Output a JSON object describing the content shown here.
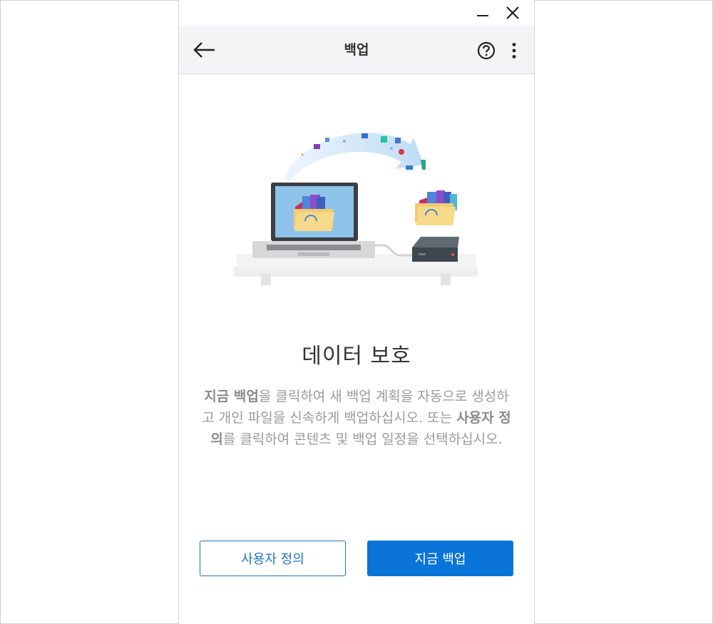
{
  "window": {
    "minimize_icon": "minimize-icon",
    "close_icon": "close-icon"
  },
  "header": {
    "title": "백업",
    "back_icon": "arrow-left-icon",
    "help_icon": "help-circle-icon",
    "more_icon": "more-vertical-icon"
  },
  "main": {
    "heading": "데이터 보호",
    "description": {
      "bold1": "지금 백업",
      "text1": "을 클릭하여 새 백업 계획을 자동으로 생성하고 개인 파일을 신속하게 백업하십시오. 또는 ",
      "bold2": "사용자 정의",
      "text2": "를 클릭하여 콘텐츠 및 백업 일정을 선택하십시오."
    }
  },
  "buttons": {
    "custom_label": "사용자 정의",
    "backup_now_label": "지금 백업"
  },
  "colors": {
    "primary": "#0a74d9",
    "header_bg": "#f4f4f6",
    "text_dark": "#333333",
    "text_muted": "#9a9a9a"
  }
}
